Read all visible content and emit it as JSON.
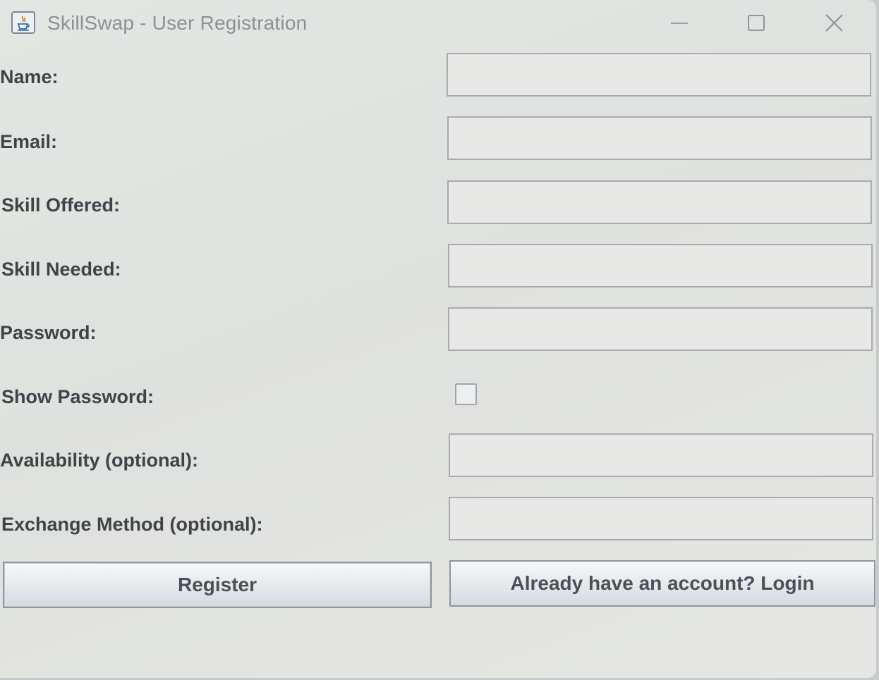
{
  "window": {
    "title": "SkillSwap - User Registration",
    "icon": "java-cup-icon",
    "controls": [
      "minimize-icon",
      "maximize-icon",
      "close-icon"
    ]
  },
  "form": {
    "fields": [
      {
        "label": "Name:",
        "value": "",
        "type": "text"
      },
      {
        "label": "Email:",
        "value": "",
        "type": "text"
      },
      {
        "label": "Skill Offered:",
        "value": "",
        "type": "text"
      },
      {
        "label": "Skill Needed:",
        "value": "",
        "type": "text"
      },
      {
        "label": "Password:",
        "value": "",
        "type": "password"
      },
      {
        "label": "Show Password:",
        "checked": false,
        "type": "checkbox"
      },
      {
        "label": "Availability (optional):",
        "value": "",
        "type": "text"
      },
      {
        "label": "Exchange Method (optional):",
        "value": "",
        "type": "text"
      }
    ]
  },
  "buttons": {
    "register": "Register",
    "login": "Already have an account? Login"
  },
  "colors": {
    "background": "#e2e4e1",
    "label_text": "#3f4448",
    "title_text": "#8c9196",
    "input_border": "#a7acb0"
  }
}
